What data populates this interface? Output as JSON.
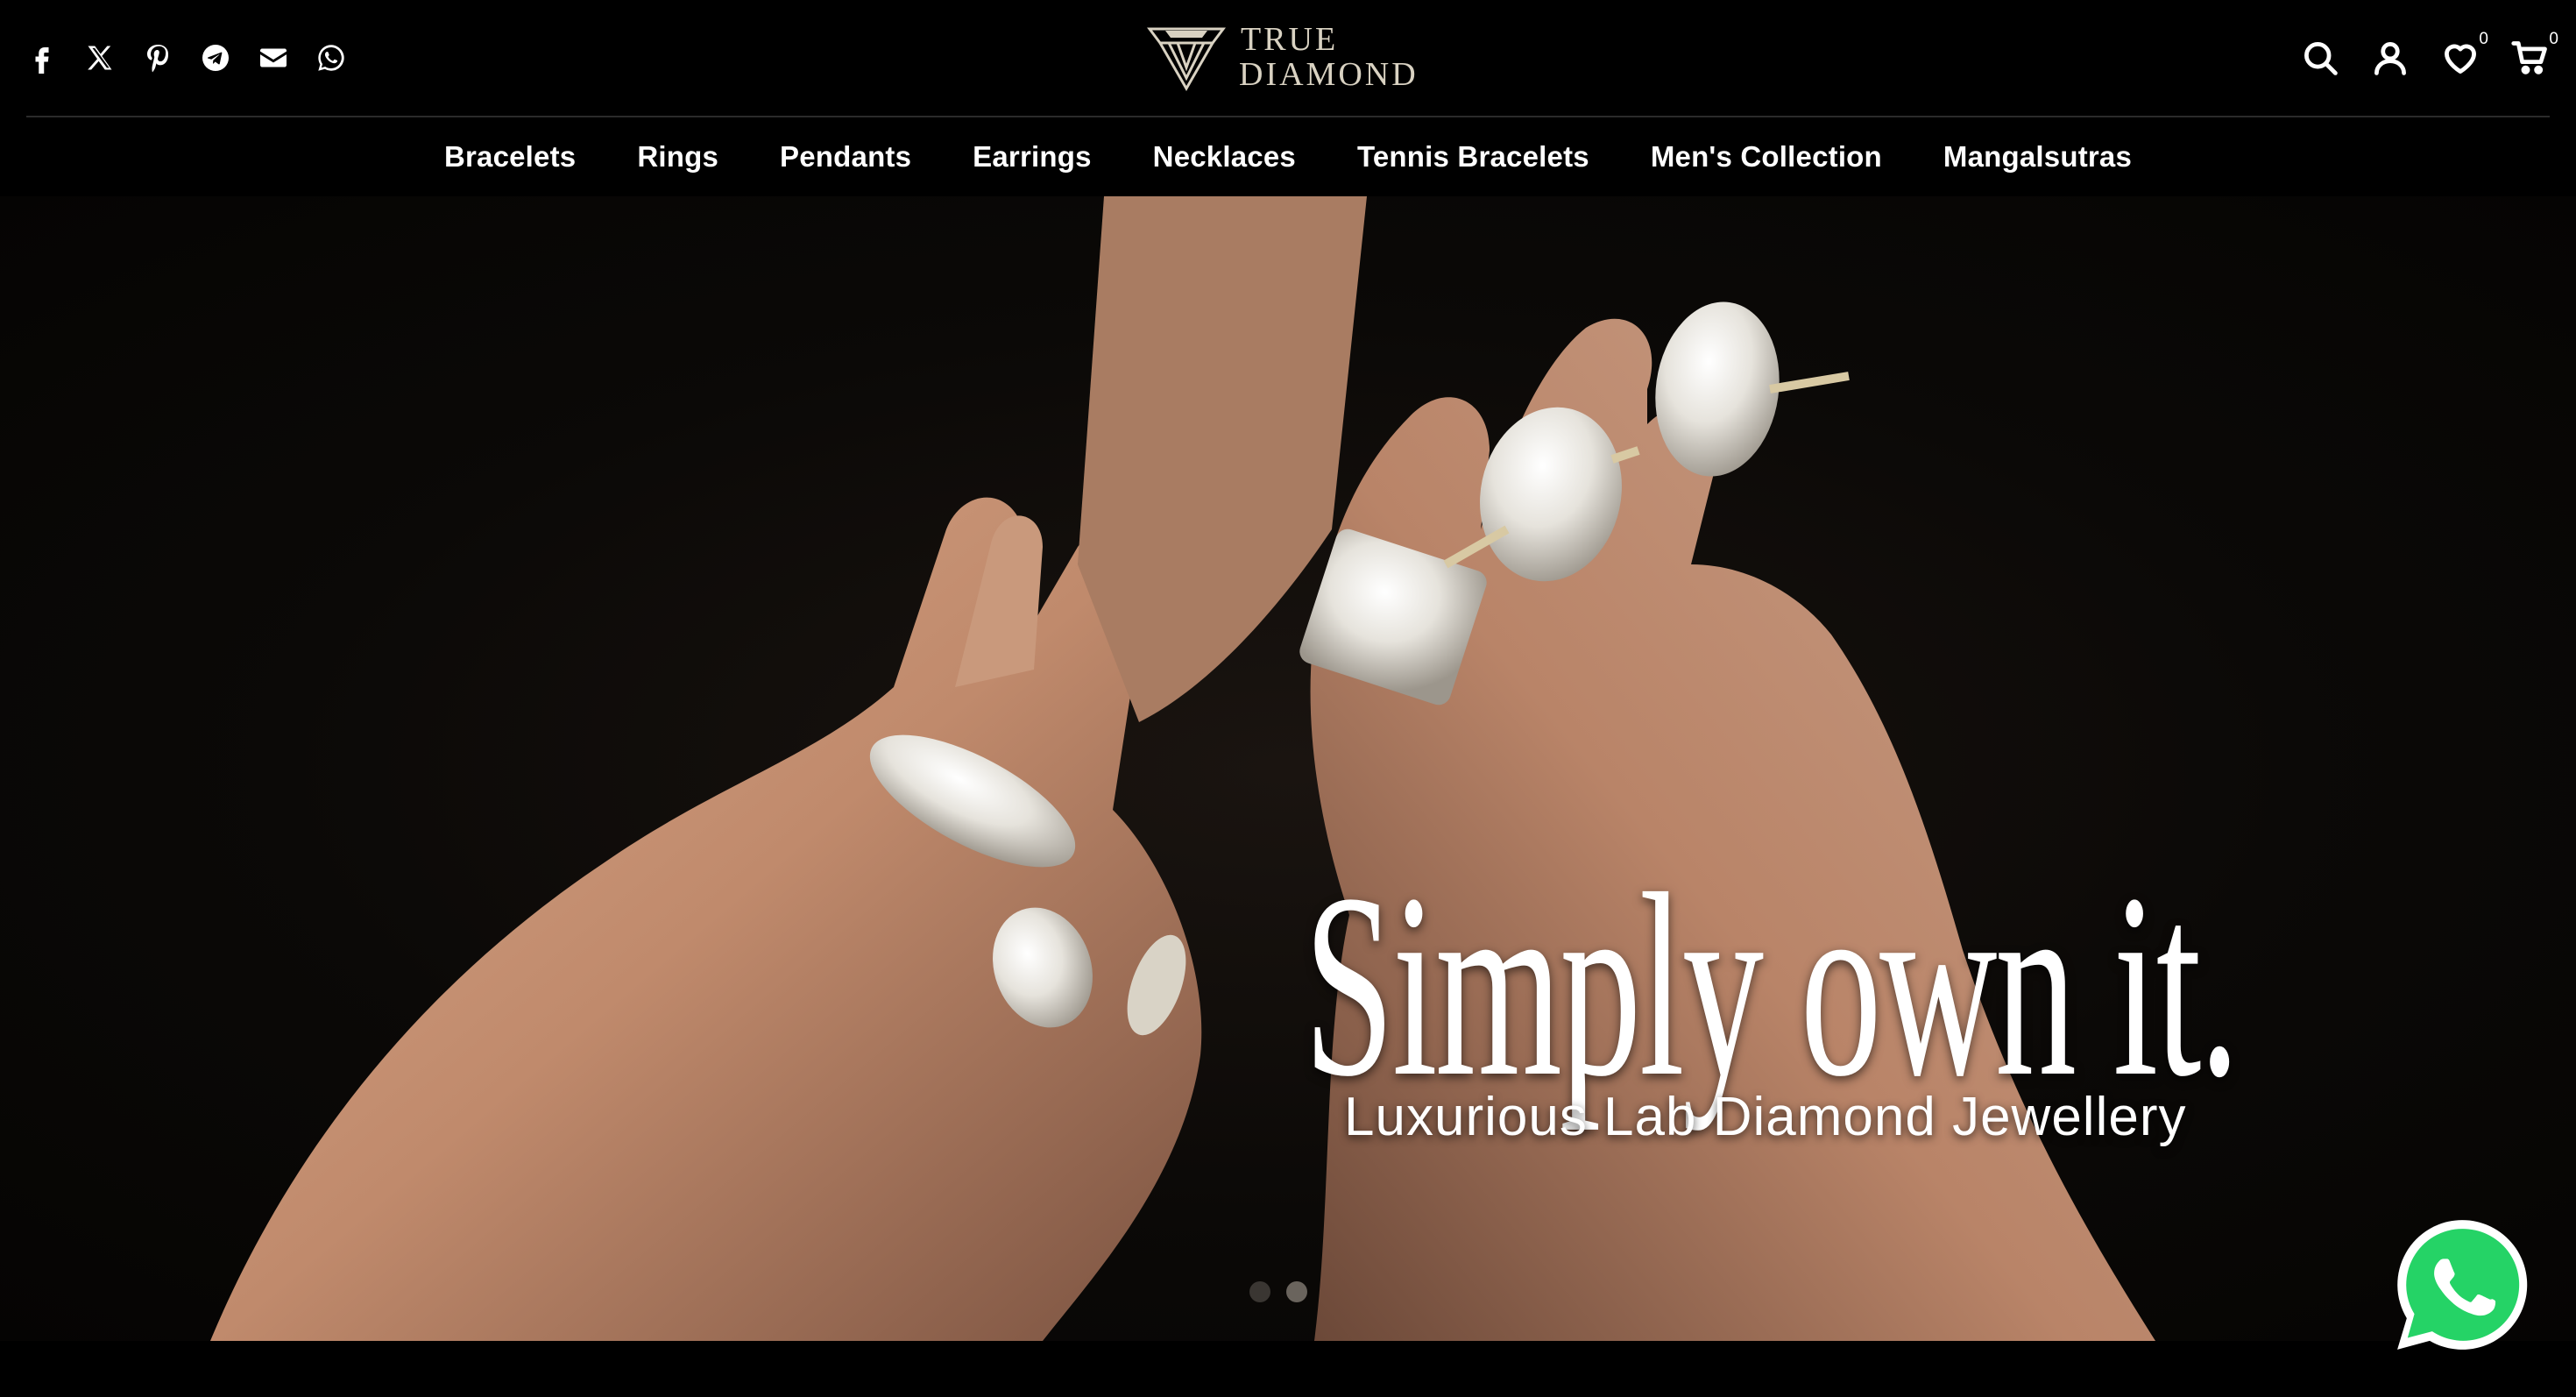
{
  "header": {
    "social_icons": [
      "facebook-icon",
      "x-twitter-icon",
      "pinterest-icon",
      "telegram-icon",
      "email-icon",
      "whatsapp-icon"
    ],
    "logo": {
      "line1": "TRUE",
      "line2": "DIAMOND",
      "color": "#d9d2c2"
    },
    "tools": {
      "search_icon": "search-icon",
      "account_icon": "user-icon",
      "wishlist_icon": "heart-icon",
      "wishlist_count": "0",
      "cart_icon": "cart-icon",
      "cart_count": "0"
    }
  },
  "nav": {
    "items": [
      {
        "label": "Bracelets"
      },
      {
        "label": "Rings"
      },
      {
        "label": "Pendants"
      },
      {
        "label": "Earrings"
      },
      {
        "label": "Necklaces"
      },
      {
        "label": "Tennis Bracelets"
      },
      {
        "label": "Men's Collection"
      },
      {
        "label": "Mangalsutras"
      }
    ]
  },
  "hero": {
    "headline": "Simply own it.",
    "subheadline": "Luxurious Lab Diamond Jewellery",
    "slides_total": 2,
    "active_slide": 2
  },
  "floating": {
    "whatsapp_icon": "whatsapp-icon",
    "color": "#25d366"
  }
}
